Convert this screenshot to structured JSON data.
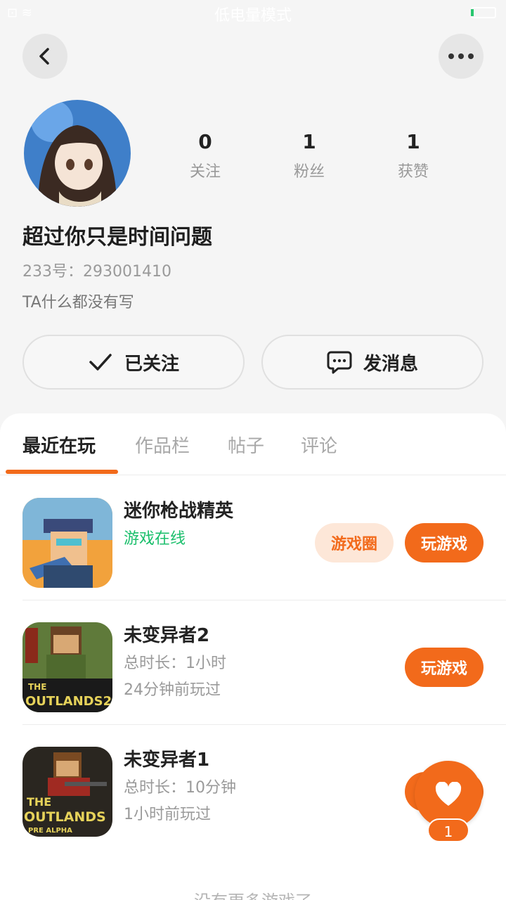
{
  "status_bar": {
    "mode_text": "低电量模式",
    "left_icons": "⊡ ≋"
  },
  "header": {
    "back_icon": "chevron-left-icon",
    "more_icon": "more-dots-icon"
  },
  "profile": {
    "username": "超过你只是时间问题",
    "id_text": "233号：293001410",
    "bio": "TA什么都没有写",
    "stats": [
      {
        "value": "0",
        "label": "关注"
      },
      {
        "value": "1",
        "label": "粉丝"
      },
      {
        "value": "1",
        "label": "获赞"
      }
    ],
    "follow_label": "已关注",
    "message_label": "发消息"
  },
  "tabs": [
    {
      "label": "最近在玩"
    },
    {
      "label": "作品栏"
    },
    {
      "label": "帖子"
    },
    {
      "label": "评论"
    }
  ],
  "games": [
    {
      "name": "迷你枪战精英",
      "status": "游戏在线",
      "circle_label": "游戏圈",
      "play_label": "玩游戏"
    },
    {
      "name": "未变异者2",
      "duration": "总时长：1小时",
      "last_played": "24分钟前玩过",
      "play_label": "玩游戏"
    },
    {
      "name": "未变异者1",
      "duration": "总时长：10分钟",
      "last_played": "1小时前玩过",
      "play_label": "玩游戏"
    }
  ],
  "like_fab": {
    "count": "1",
    "icon": "heart-icon"
  },
  "footer": {
    "no_more": "没有更多游戏了"
  },
  "colors": {
    "accent": "#f26a1b",
    "online": "#1bbf6c",
    "background": "#f5f5f5"
  }
}
